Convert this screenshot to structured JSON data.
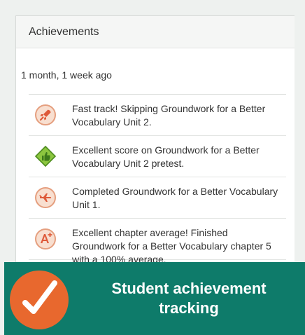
{
  "panel": {
    "title": "Achievements",
    "date": "1 month, 1 week ago"
  },
  "achievements": [
    {
      "text": "Fast track! Skipping Groundwork for a Better Vocabulary Unit 2.",
      "icon": "rocket-badge-icon",
      "color": "#f8dfd0"
    },
    {
      "text": "Excellent score on Groundwork for a Better Vocabulary Unit 2 pretest.",
      "icon": "thumbs-up-badge-icon",
      "color": "#8cc63f"
    },
    {
      "text": "Completed Groundwork for a Better Vocabulary Unit 1.",
      "icon": "airplane-badge-icon",
      "color": "#f8dfd0"
    },
    {
      "text": "Excellent chapter average! Finished Groundwork for a Better Vocabulary chapter 5 with a 100% average.",
      "icon": "a-plus-badge-icon",
      "color": "#f8dfd0"
    }
  ],
  "banner": {
    "text": "Student achievement tracking",
    "icon": "checkmark-icon",
    "accent_color": "#e8682e",
    "background_color": "#0e7b6a"
  }
}
